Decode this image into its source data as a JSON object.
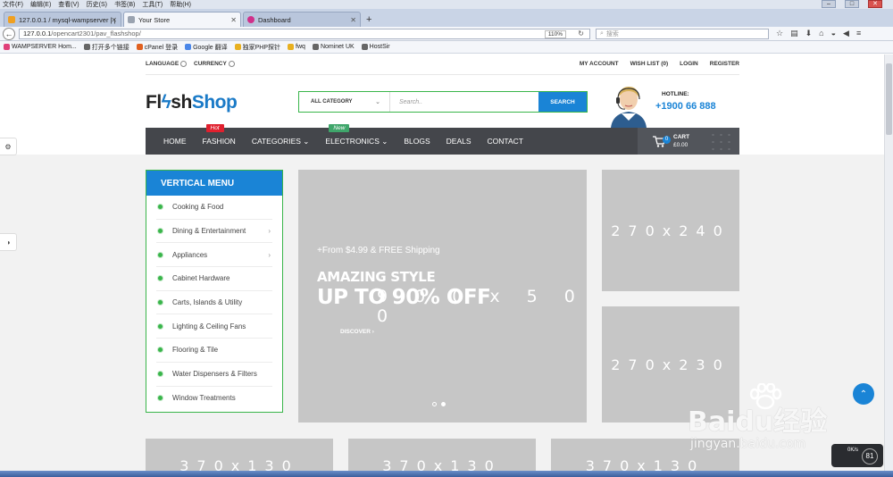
{
  "menubar": {
    "items": [
      "文件(F)",
      "编辑(E)",
      "查看(V)",
      "历史(S)",
      "书签(B)",
      "工具(T)",
      "帮助(H)"
    ]
  },
  "tabs": [
    {
      "title": "127.0.0.1 / mysql-wampserver | ph",
      "active": false,
      "color": "#f0a020"
    },
    {
      "title": "Your Store",
      "active": true,
      "color": "#9aa3b0"
    },
    {
      "title": "Dashboard",
      "active": false,
      "color": "#d0308a"
    }
  ],
  "navbar": {
    "url_host": "127.0.0.1",
    "url_path": "/opencart2301/pav_flashshop/",
    "zoom": "110%",
    "search_placeholder": "搜索"
  },
  "bookmarks": [
    {
      "label": "WAMPSERVER Hom...",
      "color": "#e0407a"
    },
    {
      "label": "打开多个链接",
      "color": "#666"
    },
    {
      "label": "cPanel 登录",
      "color": "#e06020"
    },
    {
      "label": "Google 翻译",
      "color": "#4a86e8"
    },
    {
      "label": "独家PHP探针",
      "color": "#e8b020"
    },
    {
      "label": "fwq",
      "color": "#e8b020"
    },
    {
      "label": "Nominet UK",
      "color": "#666"
    },
    {
      "label": "HostSir",
      "color": "#666"
    }
  ],
  "topbar": {
    "language": "LANGUAGE",
    "currency": "CURRENCY",
    "links": [
      "MY ACCOUNT",
      "WISH LIST (0)",
      "LOGIN",
      "REGISTER"
    ]
  },
  "logo": {
    "part1": "Fl",
    "part2": "sh",
    "part3": "Shop"
  },
  "search": {
    "category": "ALL CATEGORY",
    "placeholder": "Search..",
    "button": "SEARCH"
  },
  "hotline": {
    "label": "HOTLINE:",
    "number": "+1900 66 888"
  },
  "nav": {
    "items": [
      "HOME",
      "FASHION",
      "CATEGORIES ⌄",
      "ELECTRONICS ⌄",
      "BLOGS",
      "DEALS",
      "CONTACT"
    ],
    "badge_hot": "Hot",
    "badge_new": "New"
  },
  "cart": {
    "count": "0",
    "label": "CART",
    "total": "£0.00"
  },
  "vertical_menu": {
    "title": "VERTICAL MENU",
    "items": [
      {
        "label": "Cooking & Food",
        "arrow": false
      },
      {
        "label": "Dining & Entertainment",
        "arrow": true
      },
      {
        "label": "Appliances",
        "arrow": true
      },
      {
        "label": "Cabinet Hardware",
        "arrow": false
      },
      {
        "label": "Carts, Islands & Utility",
        "arrow": false
      },
      {
        "label": "Lighting & Ceiling Fans",
        "arrow": false
      },
      {
        "label": "Flooring & Tile",
        "arrow": false
      },
      {
        "label": "Water Dispensers & Filters",
        "arrow": false
      },
      {
        "label": "Window Treatments",
        "arrow": false
      }
    ]
  },
  "slider": {
    "shipping": "+From $4.99 & FREE Shipping",
    "heading": "AMAZING STYLE",
    "offer": "UP TO 90% OFF",
    "placeholder": "9 0 0 x 5 0 0",
    "discover": "DISCOVER  ›"
  },
  "banners": {
    "right_top": "270x240",
    "right_bottom": "270x230",
    "bottom_1": "370x130",
    "bottom_2": "370x130",
    "bottom_3": "370x130"
  },
  "watermark": {
    "main": "Baidu经验",
    "sub": "jingyan.baidu.com"
  },
  "speed": {
    "rate": "0K/s",
    "percent": "81"
  }
}
